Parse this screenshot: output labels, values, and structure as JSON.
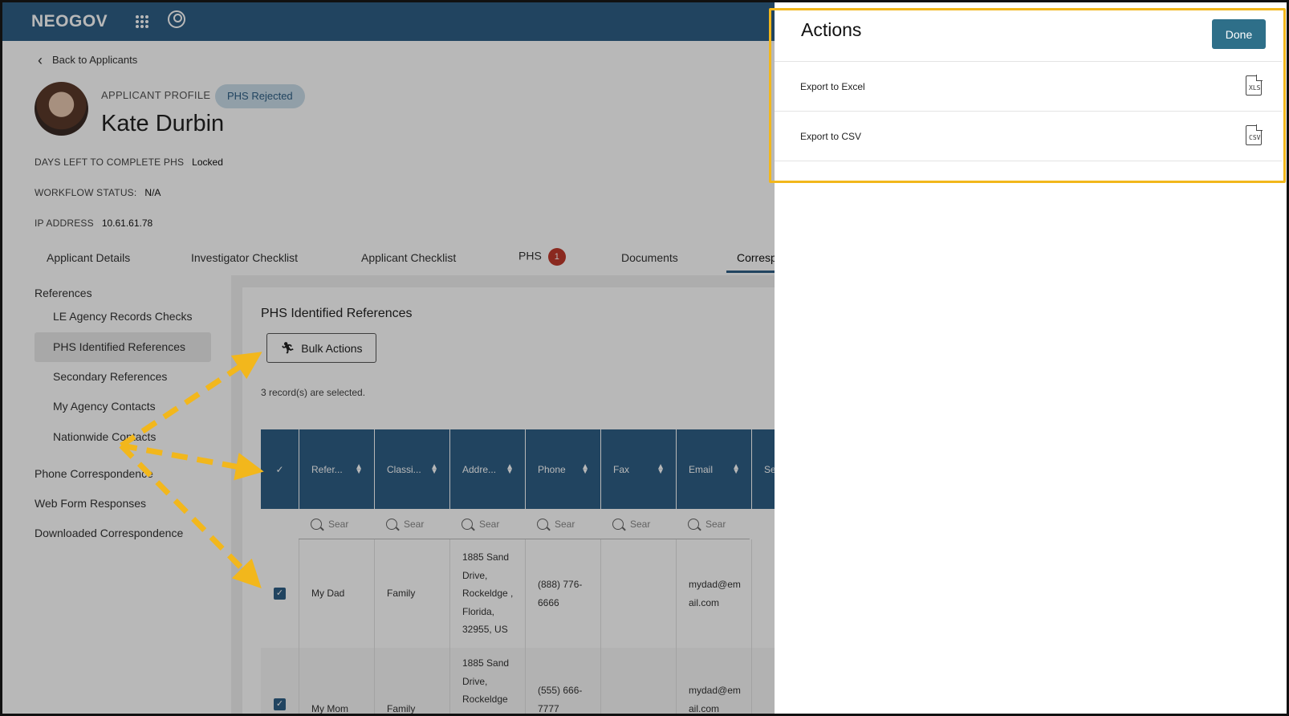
{
  "topbar": {
    "logo": "NEOGOV",
    "apps_icon": "apps-grid-icon",
    "user_icon": "user-circle-icon"
  },
  "back_link": "Back to Applicants",
  "profile": {
    "label": "APPLICANT PROFILE",
    "status": "PHS Rejected",
    "name": "Kate Durbin",
    "days_left_label": "DAYS LEFT TO COMPLETE PHS",
    "days_left_value": "Locked",
    "workflow_label": "WORKFLOW STATUS:",
    "workflow_value": "N/A",
    "ip_label": "IP ADDRESS",
    "ip_value": "10.61.61.78"
  },
  "tabs": [
    {
      "label": "Applicant Details"
    },
    {
      "label": "Investigator Checklist"
    },
    {
      "label": "Applicant Checklist"
    },
    {
      "label": "PHS",
      "badge": "1"
    },
    {
      "label": "Documents"
    },
    {
      "label": "Corresp"
    }
  ],
  "sidenav": {
    "references_header": "References",
    "items": [
      "LE Agency Records Checks",
      "PHS Identified References",
      "Secondary References",
      "My Agency Contacts",
      "Nationwide Contacts"
    ],
    "other_sections": [
      "Phone Correspondence",
      "Web Form Responses",
      "Downloaded Correspondence"
    ]
  },
  "main": {
    "section_title": "PHS Identified References",
    "bulk_actions_label": "Bulk Actions",
    "selected_note": "3 record(s) are selected."
  },
  "table": {
    "columns": [
      "Refer...",
      "Classi...",
      "Addre...",
      "Phone",
      "Fax",
      "Email",
      "Se"
    ],
    "filter_placeholder": "Sear",
    "rows": [
      {
        "reference": "My Dad",
        "classification": "Family",
        "address": "1885 Sand Drive, Rockeldge , Florida, 32955, US",
        "phone": "(888) 776-6666",
        "fax": "",
        "email": "mydad@email.com",
        "checked": true
      },
      {
        "reference": "My Mom",
        "classification": "Family",
        "address": "1885 Sand Drive, Rockeldge",
        "phone": "(555) 666-7777",
        "fax": "",
        "email": "mydad@email.com",
        "checked": true
      }
    ]
  },
  "drawer": {
    "title": "Actions",
    "done_label": "Done",
    "actions": [
      {
        "label": "Export to Excel",
        "icon": "xls-file-icon",
        "icon_text": "XLS"
      },
      {
        "label": "Export to CSV",
        "icon": "csv-file-icon",
        "icon_text": "CSV"
      }
    ]
  },
  "colors": {
    "brand": "#2e5f85",
    "highlight": "#f2b71c",
    "badge": "#c0392b"
  }
}
